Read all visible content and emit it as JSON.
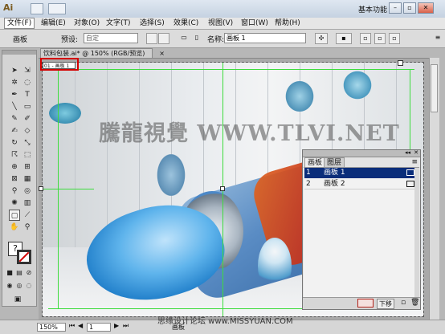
{
  "app": {
    "logo": "Ai",
    "workspace": "基本功能",
    "workspace_arrow": "▼"
  },
  "title_icons": [
    "bridge-icon",
    "arrange-icon"
  ],
  "window_controls": {
    "minimize": "–",
    "restore": "▫",
    "close": "✕"
  },
  "menu": [
    "文件(F)",
    "编辑(E)",
    "对象(O)",
    "文字(T)",
    "选择(S)",
    "效果(C)",
    "视图(V)",
    "窗口(W)",
    "帮助(H)"
  ],
  "control": {
    "context_label": "画板",
    "preset_label": "预设:",
    "preset_value": "自定",
    "name_label": "名称:",
    "name_value": "画板 1"
  },
  "document": {
    "tab_label": "饮料包装.ai* @ 150% (RGB/预览)",
    "tab_close": "×",
    "artboard_label": "01 - 画板 1"
  },
  "artwork": {
    "watermark": "騰龍視覺 WWW.TLVI.NET"
  },
  "artboards_panel": {
    "tabs": [
      "画板",
      "图层"
    ],
    "rows": [
      {
        "num": "1",
        "name": "画板 1",
        "selected": true
      },
      {
        "num": "2",
        "name": "画板 2",
        "selected": false
      }
    ],
    "footer_button": "下移"
  },
  "status": {
    "zoom": "150%",
    "page": "1",
    "status_text": "画板",
    "footer_watermark": "思缘设计论坛 www.MISSYUAN.COM"
  },
  "colors": {
    "accent_selected": "#0a2d7a",
    "guide": "#3ddc3d",
    "highlight": "#d40000"
  }
}
